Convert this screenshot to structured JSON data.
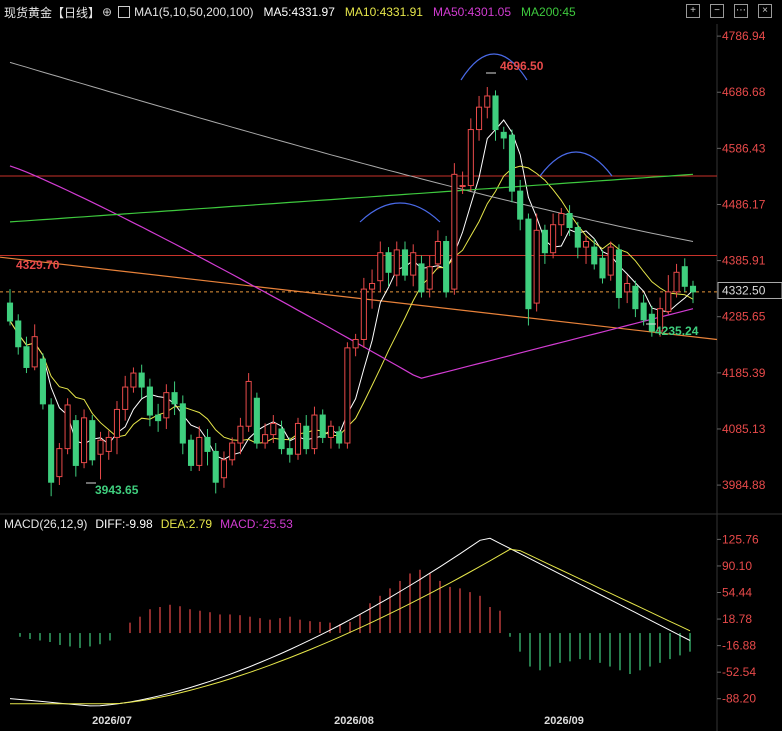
{
  "header": {
    "title": "现货黄金【日线】",
    "ma_label": "MA1(5,10,50,200,100)",
    "ma5": "MA5:4331.97",
    "ma10": "MA10:4331.91",
    "ma50": "MA50:4301.05",
    "ma200": "MA200:45"
  },
  "macd_header": {
    "label": "MACD(26,12,9)",
    "diff": "DIFF:-9.98",
    "dea": "DEA:2.79",
    "macd": "MACD:-25.53"
  },
  "colors": {
    "up": "#e84a4a",
    "down": "#3fcf7e",
    "ma5": "#ffffff",
    "ma10": "#e6e64a",
    "ma50": "#d23cd2",
    "ma200": "#3ec93e",
    "ma100": "#aaaaaa"
  },
  "chart_data": [
    {
      "type": "candlestick",
      "y_ticks": [
        "4786.94",
        "4686.68",
        "4586.43",
        "4486.17",
        "4385.91",
        "4285.65",
        "4185.39",
        "4085.13",
        "3984.88"
      ],
      "ylim": [
        3935,
        4805
      ],
      "x_ticks": [
        "2026/07",
        "2026/08",
        "2026/09"
      ],
      "current_price": "4332.50",
      "annotations": {
        "high": "4696.50",
        "low": "3943.65",
        "recent_low": "4235.24",
        "left_level": "4329.70"
      },
      "horizontal_levels": [
        4537,
        4395,
        4330
      ],
      "candles": [
        [
          4310,
          4278,
          4335,
          4270
        ],
        [
          4278,
          4232,
          4290,
          4218
        ],
        [
          4232,
          4195,
          4250,
          4185
        ],
        [
          4196,
          4250,
          4272,
          4190
        ],
        [
          4210,
          4130,
          4220,
          4120
        ],
        [
          4128,
          3990,
          4140,
          3965
        ],
        [
          4000,
          4050,
          4060,
          3985
        ],
        [
          4050,
          4128,
          4140,
          4040
        ],
        [
          4100,
          4020,
          4110,
          4000
        ],
        [
          4025,
          4105,
          4120,
          4015
        ],
        [
          4100,
          4030,
          4110,
          4020
        ],
        [
          4040,
          4065,
          4080,
          3995
        ],
        [
          4045,
          4070,
          4082,
          4030
        ],
        [
          4070,
          4120,
          4135,
          4040
        ],
        [
          4120,
          4160,
          4180,
          4100
        ],
        [
          4160,
          4185,
          4195,
          4150
        ],
        [
          4185,
          4160,
          4200,
          4140
        ],
        [
          4160,
          4110,
          4175,
          4090
        ],
        [
          4110,
          4100,
          4130,
          4080
        ],
        [
          4105,
          4150,
          4165,
          4085
        ],
        [
          4150,
          4130,
          4170,
          4110
        ],
        [
          4130,
          4060,
          4145,
          4040
        ],
        [
          4065,
          4020,
          4075,
          4010
        ],
        [
          4020,
          4070,
          4090,
          4010
        ],
        [
          4070,
          4045,
          4085,
          4020
        ],
        [
          4045,
          3990,
          4060,
          3970
        ],
        [
          3998,
          4030,
          4045,
          3980
        ],
        [
          4030,
          4060,
          4070,
          4020
        ],
        [
          4060,
          4090,
          4105,
          4040
        ],
        [
          4090,
          4170,
          4185,
          4080
        ],
        [
          4140,
          4060,
          4150,
          4050
        ],
        [
          4060,
          4075,
          4095,
          4050
        ],
        [
          4075,
          4095,
          4110,
          4060
        ],
        [
          4085,
          4050,
          4100,
          4040
        ],
        [
          4050,
          4040,
          4070,
          4025
        ],
        [
          4040,
          4095,
          4105,
          4030
        ],
        [
          4090,
          4050,
          4110,
          4040
        ],
        [
          4050,
          4110,
          4125,
          4040
        ],
        [
          4110,
          4070,
          4120,
          4060
        ],
        [
          4070,
          4090,
          4100,
          4050
        ],
        [
          4080,
          4060,
          4090,
          4050
        ],
        [
          4060,
          4230,
          4240,
          4050
        ],
        [
          4230,
          4245,
          4255,
          4215
        ],
        [
          4245,
          4335,
          4355,
          4230
        ],
        [
          4335,
          4345,
          4370,
          4300
        ],
        [
          4350,
          4400,
          4420,
          4330
        ],
        [
          4400,
          4365,
          4410,
          4340
        ],
        [
          4360,
          4405,
          4420,
          4340
        ],
        [
          4405,
          4360,
          4420,
          4350
        ],
        [
          4360,
          4400,
          4415,
          4340
        ],
        [
          4380,
          4330,
          4395,
          4320
        ],
        [
          4335,
          4375,
          4395,
          4320
        ],
        [
          4380,
          4420,
          4440,
          4370
        ],
        [
          4420,
          4330,
          4430,
          4320
        ],
        [
          4335,
          4540,
          4560,
          4325
        ],
        [
          4520,
          4520,
          4545,
          4505
        ],
        [
          4520,
          4620,
          4640,
          4510
        ],
        [
          4620,
          4660,
          4680,
          4600
        ],
        [
          4660,
          4680,
          4696,
          4640
        ],
        [
          4680,
          4620,
          4690,
          4600
        ],
        [
          4615,
          4605,
          4625,
          4585
        ],
        [
          4610,
          4510,
          4620,
          4490
        ],
        [
          4510,
          4460,
          4530,
          4440
        ],
        [
          4460,
          4300,
          4470,
          4270
        ],
        [
          4310,
          4440,
          4470,
          4295
        ],
        [
          4440,
          4400,
          4450,
          4380
        ],
        [
          4400,
          4450,
          4470,
          4390
        ],
        [
          4450,
          4470,
          4480,
          4430
        ],
        [
          4470,
          4445,
          4485,
          4430
        ],
        [
          4445,
          4410,
          4455,
          4390
        ],
        [
          4410,
          4420,
          4430,
          4380
        ],
        [
          4410,
          4380,
          4425,
          4370
        ],
        [
          4390,
          4355,
          4405,
          4345
        ],
        [
          4360,
          4410,
          4420,
          4350
        ],
        [
          4405,
          4320,
          4415,
          4300
        ],
        [
          4330,
          4345,
          4360,
          4310
        ],
        [
          4340,
          4300,
          4350,
          4285
        ],
        [
          4310,
          4280,
          4325,
          4270
        ],
        [
          4290,
          4260,
          4305,
          4250
        ],
        [
          4260,
          4300,
          4320,
          4250
        ],
        [
          4295,
          4330,
          4360,
          4290
        ],
        [
          4330,
          4365,
          4380,
          4320
        ],
        [
          4375,
          4340,
          4390,
          4330
        ],
        [
          4340,
          4330,
          4350,
          4310
        ]
      ]
    },
    {
      "type": "macd",
      "y_ticks": [
        "125.76",
        "90.10",
        "54.44",
        "18.78",
        "-16.88",
        "-52.54",
        "-88.20"
      ],
      "ylim": [
        -106,
        133
      ],
      "histogram": [
        0,
        -5,
        -8,
        -10,
        -12,
        -16,
        -18,
        -20,
        -18,
        -15,
        -10,
        0,
        14,
        22,
        32,
        35,
        38,
        36,
        32,
        30,
        28,
        25,
        25,
        24,
        22,
        20,
        18,
        20,
        22,
        18,
        16,
        15,
        14,
        12,
        15,
        25,
        40,
        50,
        60,
        70,
        80,
        85,
        80,
        70,
        62,
        60,
        55,
        50,
        35,
        30,
        -5,
        -25,
        -45,
        -50,
        -45,
        -40,
        -38,
        -35,
        -36,
        -40,
        -45,
        -50,
        -55,
        -50,
        -45,
        -40,
        -35,
        -30,
        -25
      ],
      "hist_start": 0,
      "hist_positions": "spread"
    }
  ]
}
